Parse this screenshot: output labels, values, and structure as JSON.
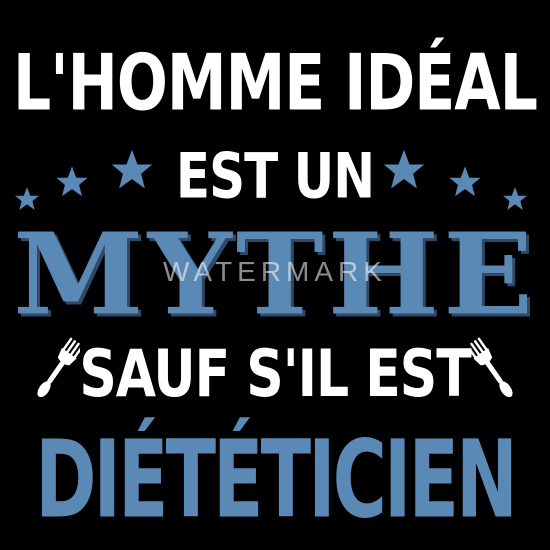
{
  "design": {
    "line1": "L'HOMME IDÉAL",
    "line2": "EST UN",
    "line3": "MYTHE",
    "line4": "SAUF S'IL EST",
    "line5": "DIÉTÉTICIEN"
  },
  "watermark": "WATERMARK",
  "colors": {
    "background": "#000000",
    "text_white": "#ffffff",
    "accent_blue": "#5b89b6"
  },
  "icons": [
    "star-icon",
    "fork-icon"
  ]
}
